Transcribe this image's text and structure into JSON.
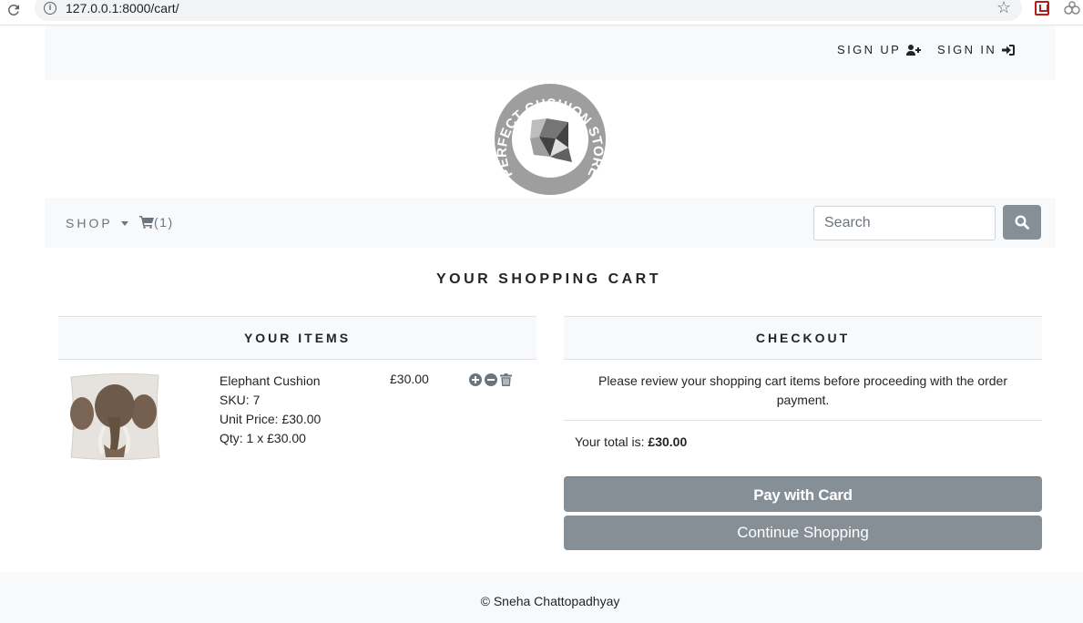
{
  "browser": {
    "url": "127.0.0.1:8000/cart/"
  },
  "topnav": {
    "sign_up": "SIGN UP",
    "sign_in": "SIGN IN"
  },
  "logo": {
    "text": "PERFECT CUSHION STORE"
  },
  "subnav": {
    "shop": "SHOP",
    "cart_count": "(1)",
    "search_placeholder": "Search"
  },
  "page": {
    "title": "YOUR SHOPPING CART"
  },
  "items_panel": {
    "heading": "YOUR ITEMS",
    "items": [
      {
        "name": "Elephant Cushion",
        "sku": "SKU: 7",
        "unit_price": "Unit Price: £30.00",
        "qty": "Qty: 1 x £30.00",
        "price": "£30.00",
        "image": "elephant-cushion"
      }
    ]
  },
  "checkout_panel": {
    "heading": "CHECKOUT",
    "review_text": "Please review your shopping cart items before proceeding with the order payment.",
    "total_label": "Your total is:",
    "total_value": "£30.00",
    "pay_button": "Pay with Card",
    "continue_button": "Continue Shopping"
  },
  "footer": {
    "text": "© Sneha Chattopadhyay"
  },
  "colors": {
    "nav_bg": "#f8f9fa",
    "secondary_btn": "#868e96",
    "muted_text": "#6c757d"
  }
}
